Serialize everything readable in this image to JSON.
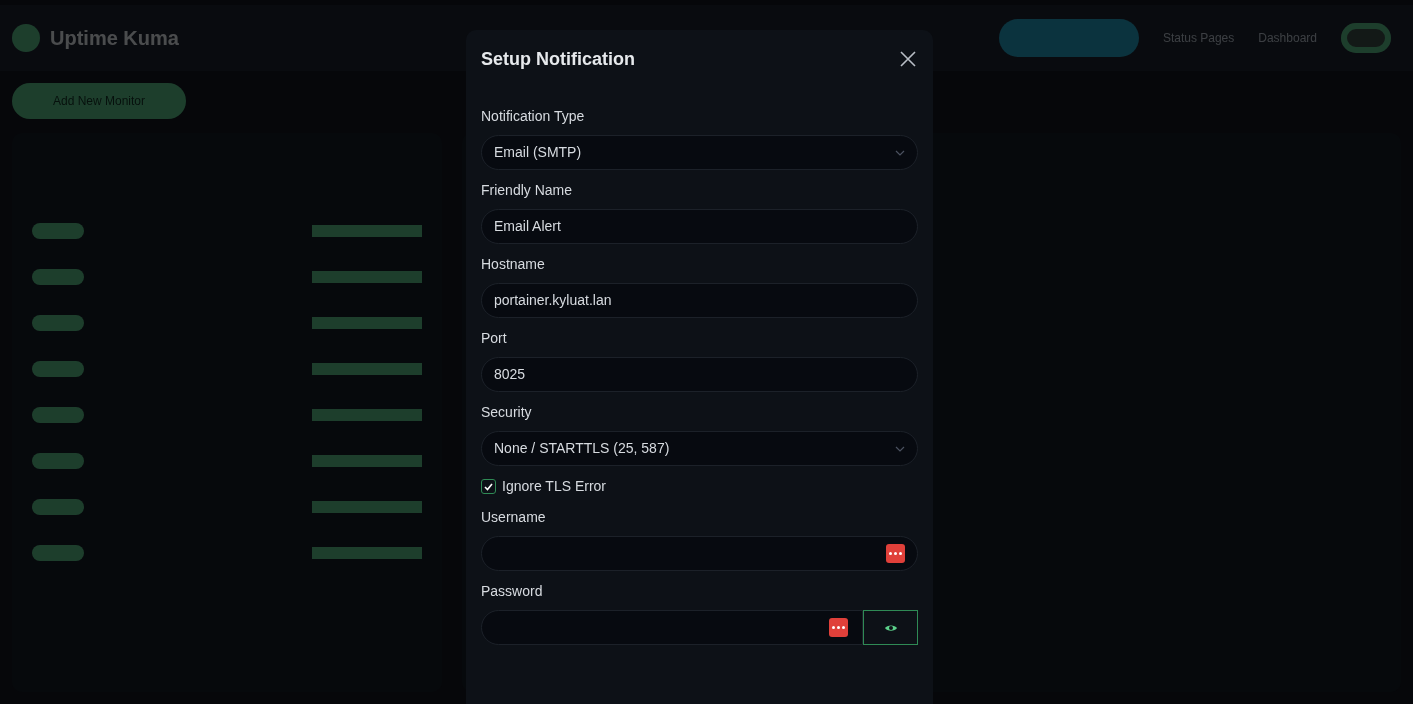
{
  "background": {
    "app_name": "Uptime Kuma",
    "nav": [
      "Status Pages",
      "Dashboard"
    ],
    "add_button": "Add New Monitor"
  },
  "dialog": {
    "title": "Setup Notification",
    "fields": [
      {
        "kind": "select",
        "label": "Notification Type",
        "value": "Email (SMTP)"
      },
      {
        "kind": "text",
        "label": "Friendly Name",
        "value": "Email Alert"
      },
      {
        "kind": "text",
        "label": "Hostname",
        "value": "portainer.kyluat.lan"
      },
      {
        "kind": "text",
        "label": "Port",
        "value": "8025"
      },
      {
        "kind": "select",
        "label": "Security",
        "value": "None / STARTTLS (25, 587)"
      },
      {
        "kind": "checkbox",
        "label": "Ignore TLS Error",
        "checked": true
      },
      {
        "kind": "username",
        "label": "Username"
      },
      {
        "kind": "password",
        "label": "Password"
      }
    ]
  }
}
